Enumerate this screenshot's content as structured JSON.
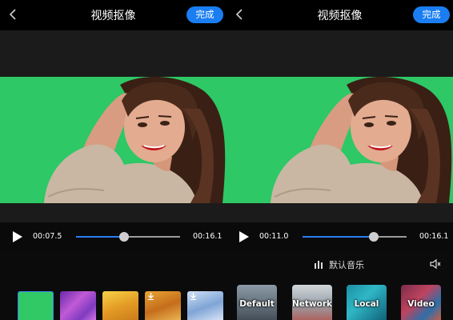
{
  "header": {
    "title": "视频抠像",
    "done_label": "完成"
  },
  "left_player": {
    "current_time": "00:07.5",
    "total_time": "00:16.1",
    "progress": 0.465
  },
  "right_player": {
    "current_time": "00:11.0",
    "total_time": "00:16.1",
    "progress": 0.683
  },
  "music": {
    "label": "默认音乐"
  },
  "backgrounds": {
    "thumbnails": [
      {
        "name": "green"
      },
      {
        "name": "purple-flowers"
      },
      {
        "name": "autumn-trees"
      },
      {
        "name": "autumn-forest",
        "download": true
      },
      {
        "name": "winter-snow",
        "download": true
      }
    ]
  },
  "categories": [
    {
      "label": "Default"
    },
    {
      "label": "Network"
    },
    {
      "label": "Local"
    },
    {
      "label": "Video"
    }
  ],
  "colors": {
    "chroma_green": "#2ec866",
    "accent_blue": "#1a7ef2"
  }
}
